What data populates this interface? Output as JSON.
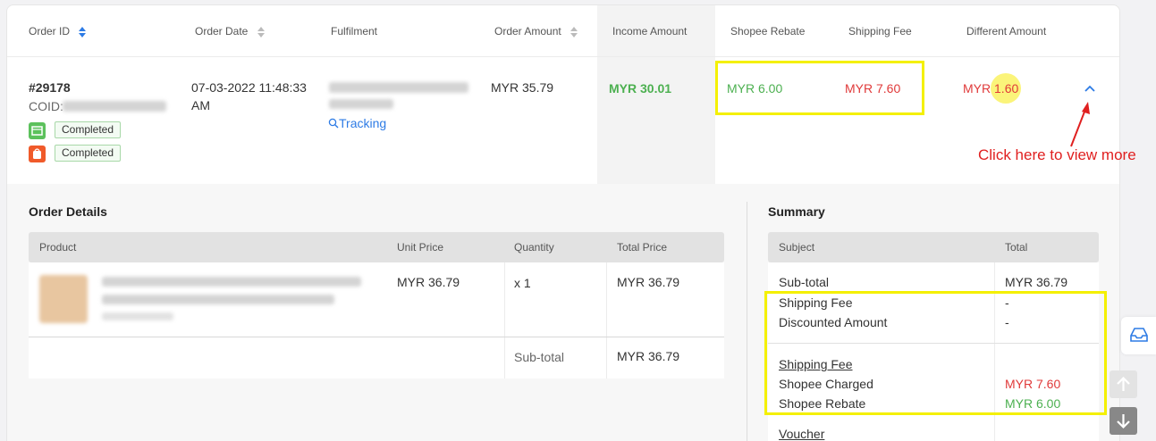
{
  "columns": {
    "order_id": "Order ID",
    "order_date": "Order Date",
    "fulfilment": "Fulfilment",
    "order_amount": "Order Amount",
    "income_amount": "Income Amount",
    "shopee_rebate": "Shopee Rebate",
    "shipping_fee": "Shipping Fee",
    "different_amount": "Different Amount"
  },
  "order": {
    "id": "#29178",
    "coid_label": "COID:",
    "status_1": "Completed",
    "status_2": "Completed",
    "date": "07-03-2022 11:48:33",
    "time_suffix": "AM",
    "tracking": "Tracking",
    "order_amount": "MYR 35.79",
    "income_amount": "MYR 30.01",
    "shopee_rebate": "MYR 6.00",
    "shipping_fee": "MYR 7.60",
    "different_currency": "MYR",
    "different_value": "1.60"
  },
  "annotation": {
    "text": "Click here to view more"
  },
  "order_details": {
    "title": "Order Details",
    "headers": [
      "Product",
      "Unit Price",
      "Quantity",
      "Total Price"
    ],
    "row": {
      "unit_price": "MYR 36.79",
      "quantity": "x 1",
      "total_price": "MYR 36.79"
    },
    "subtotal_label": "Sub-total",
    "subtotal_value": "MYR 36.79"
  },
  "summary": {
    "title": "Summary",
    "headers": [
      "Subject",
      "Total"
    ],
    "subtotal_label": "Sub-total",
    "subtotal_value": "MYR 36.79",
    "shipping_fee_label": "Shipping Fee",
    "shipping_fee_value": "-",
    "discounted_label": "Discounted Amount",
    "discounted_value": "-",
    "group_title": "Shipping Fee",
    "shopee_charged_label": "Shopee Charged",
    "shopee_charged_value": "MYR 7.60",
    "shopee_rebate_label": "Shopee Rebate",
    "shopee_rebate_value": "MYR 6.00",
    "voucher_label": "Voucher"
  },
  "colors": {
    "accent": "#2d7be5",
    "positive": "#4cb050",
    "negative": "#e03a3a",
    "highlight": "#f4f000",
    "annotation": "#e02020"
  }
}
